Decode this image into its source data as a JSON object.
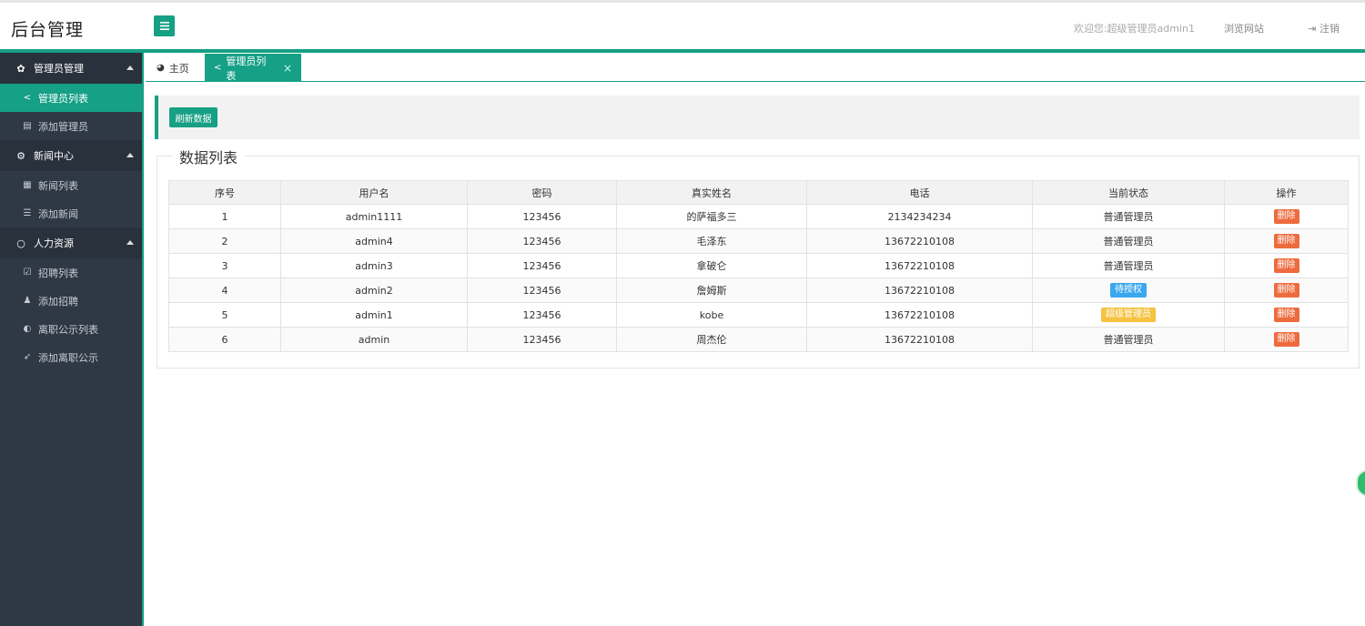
{
  "header": {
    "brand": "后台管理",
    "welcome": "欢迎您:超级管理员admin1",
    "browse": "浏览网站",
    "logout": "注销"
  },
  "sidebar": {
    "groups": [
      {
        "label": "管理员管理",
        "items": [
          "管理员列表",
          "添加管理员"
        ]
      },
      {
        "label": "新闻中心",
        "items": [
          "新闻列表",
          "添加新闻"
        ]
      },
      {
        "label": "人力资源",
        "items": [
          "招聘列表",
          "添加招聘",
          "离职公示列表",
          "添加离职公示"
        ]
      }
    ]
  },
  "tabs": [
    {
      "label": "主页"
    },
    {
      "label": "管理员列表"
    }
  ],
  "toolbar": {
    "refresh_label": "刷新数据"
  },
  "panel": {
    "title": "数据列表"
  },
  "table": {
    "headers": [
      "序号",
      "用户名",
      "密码",
      "真实姓名",
      "电话",
      "当前状态",
      "操作"
    ],
    "delete_label": "删除",
    "rows": [
      {
        "id": "1",
        "username": "admin1111",
        "password": "123456",
        "realname": "的萨福多三",
        "phone": "2134234234",
        "status": "普通管理员",
        "status_type": "plain"
      },
      {
        "id": "2",
        "username": "admin4",
        "password": "123456",
        "realname": "毛泽东",
        "phone": "13672210108",
        "status": "普通管理员",
        "status_type": "plain"
      },
      {
        "id": "3",
        "username": "admin3",
        "password": "123456",
        "realname": "拿破仑",
        "phone": "13672210108",
        "status": "普通管理员",
        "status_type": "plain"
      },
      {
        "id": "4",
        "username": "admin2",
        "password": "123456",
        "realname": "詹姆斯",
        "phone": "13672210108",
        "status": "待授权",
        "status_type": "blue"
      },
      {
        "id": "5",
        "username": "admin1",
        "password": "123456",
        "realname": "kobe",
        "phone": "13672210108",
        "status": "超级管理员",
        "status_type": "yellow"
      },
      {
        "id": "6",
        "username": "admin",
        "password": "123456",
        "realname": "周杰伦",
        "phone": "13672210108",
        "status": "普通管理员",
        "status_type": "plain"
      }
    ]
  },
  "colors": {
    "accent": "#16a085",
    "sidebar_bg": "#2f3945",
    "badge_blue": "#3aa7ee",
    "badge_yellow": "#f5c242",
    "delete": "#ee6b3e"
  }
}
